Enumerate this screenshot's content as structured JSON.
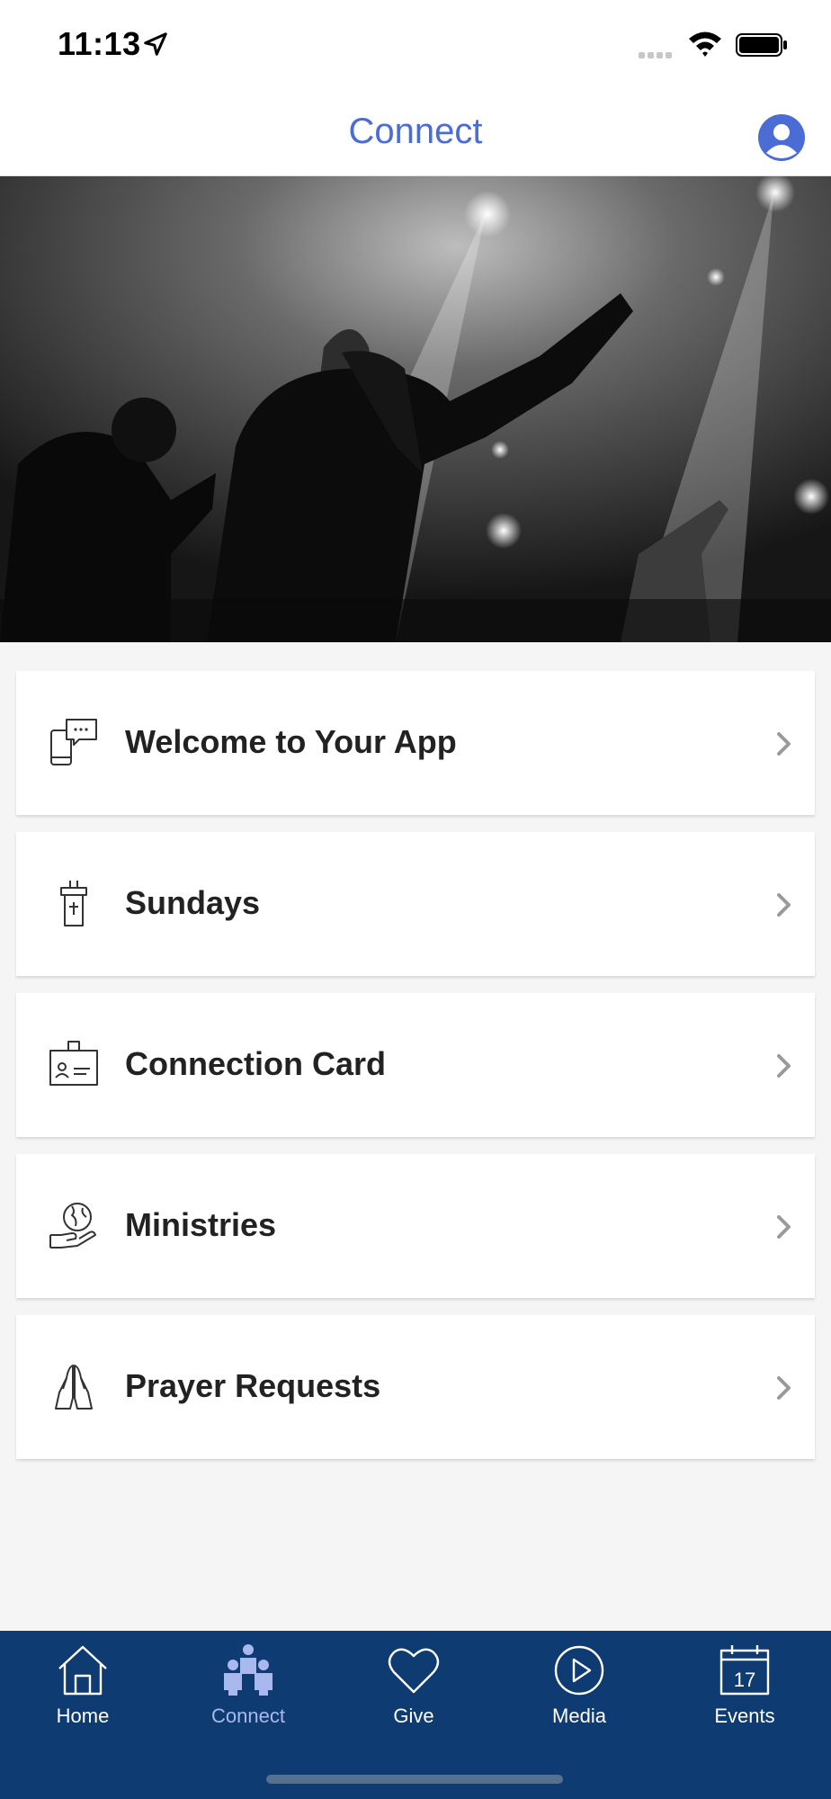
{
  "status_bar": {
    "time": "11:13"
  },
  "nav": {
    "title": "Connect"
  },
  "menu": {
    "items": [
      {
        "label": "Welcome to Your App"
      },
      {
        "label": "Sundays"
      },
      {
        "label": "Connection Card"
      },
      {
        "label": "Ministries"
      },
      {
        "label": "Prayer Requests"
      }
    ]
  },
  "tabs": [
    {
      "label": "Home",
      "icon": "home-icon"
    },
    {
      "label": "Connect",
      "icon": "people-icon",
      "active": true
    },
    {
      "label": "Give",
      "icon": "heart-icon"
    },
    {
      "label": "Media",
      "icon": "play-circle-icon"
    },
    {
      "label": "Events",
      "icon": "calendar-icon",
      "day": "17"
    }
  ],
  "colors": {
    "accent": "#4a6cd4",
    "tab_bar": "#0e3c72",
    "tab_active": "#a9b8ef"
  }
}
